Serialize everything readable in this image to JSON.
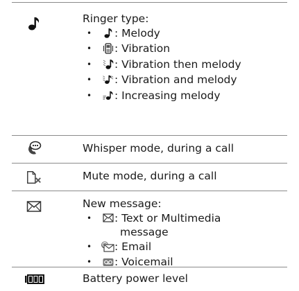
{
  "rows": [
    {
      "icon": "note-icon",
      "title": "Ringer type:",
      "bullets": [
        {
          "icon": "melody-note-icon",
          "label": ": Melody"
        },
        {
          "icon": "vibration-icon",
          "label": ": Vibration"
        },
        {
          "icon": "vibration-then-melody-icon",
          "label": ": Vibration then melody"
        },
        {
          "icon": "vibration-and-melody-icon",
          "label": ": Vibration and melody"
        },
        {
          "icon": "increasing-melody-icon",
          "label": ": Increasing melody"
        }
      ]
    },
    {
      "icon": "whisper-mode-icon",
      "title": "Whisper mode, during a call"
    },
    {
      "icon": "mute-mode-icon",
      "title": "Mute mode, during a call"
    },
    {
      "icon": "envelope-icon",
      "title": "New message:",
      "bullets": [
        {
          "icon": "envelope-small-icon",
          "label": ": Text or Multimedia",
          "label_cont": "message"
        },
        {
          "icon": "email-icon",
          "label": ": Email"
        },
        {
          "icon": "voicemail-icon",
          "label": ": Voicemail"
        }
      ]
    },
    {
      "icon": "battery-icon",
      "title": "Battery power level"
    }
  ],
  "bullet_glyph": "•"
}
